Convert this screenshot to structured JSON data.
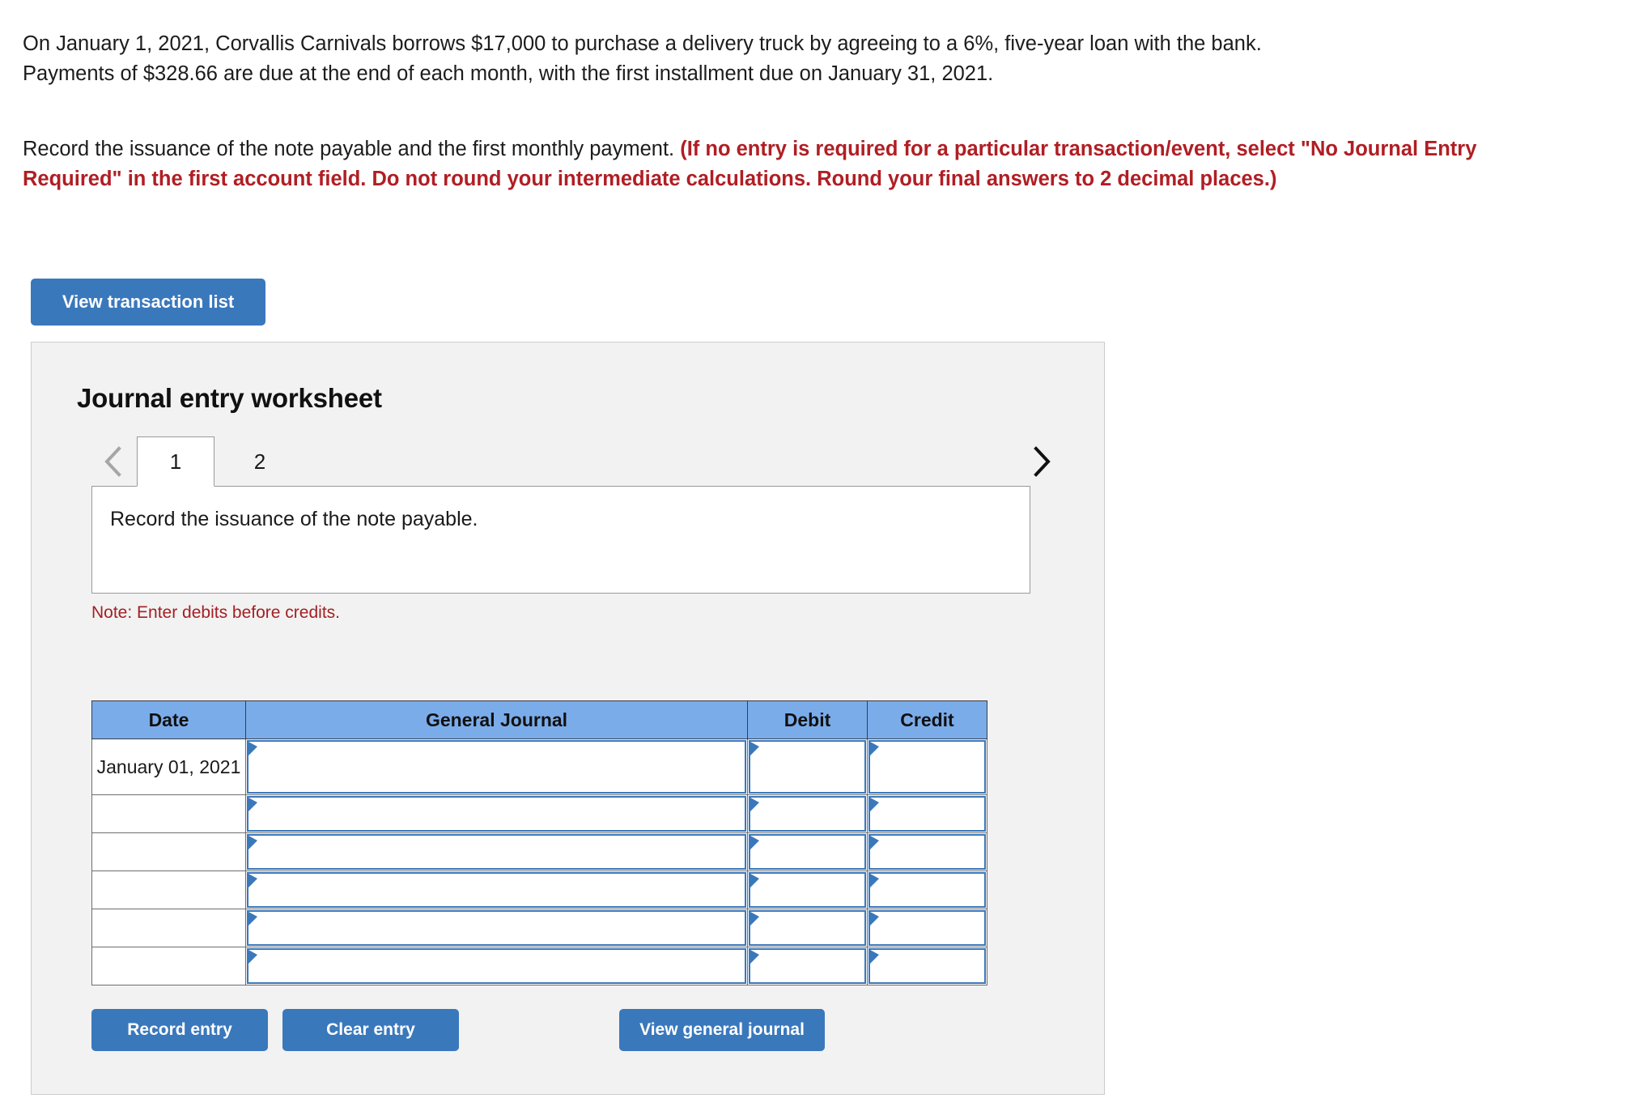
{
  "problem": {
    "line1": "On January 1, 2021, Corvallis Carnivals borrows $17,000 to purchase a delivery truck by agreeing to a 6%, five-year loan with the bank.",
    "line2": "Payments of $328.66 are due at the end of each month, with the first installment due on January 31, 2021."
  },
  "instructions": {
    "plain": "Record the issuance of the note payable and the first monthly payment. ",
    "emphasis": "(If no entry is required for a particular transaction/event, select \"No Journal Entry Required\" in the first account field. Do not round your intermediate calculations. Round your final answers to 2 decimal places.)"
  },
  "toolbar": {
    "view_transaction_list_label": "View transaction list"
  },
  "worksheet": {
    "title": "Journal entry worksheet",
    "tabs": [
      {
        "label": "1",
        "active": true
      },
      {
        "label": "2",
        "active": false
      }
    ],
    "prev_arrow": "chevron-left",
    "next_arrow": "chevron-right",
    "description": "Record the issuance of the note payable.",
    "note": "Note: Enter debits before credits.",
    "table": {
      "headers": [
        "Date",
        "General Journal",
        "Debit",
        "Credit"
      ],
      "rows": [
        {
          "date": "January 01, 2021",
          "general_journal": "",
          "debit": "",
          "credit": ""
        },
        {
          "date": "",
          "general_journal": "",
          "debit": "",
          "credit": ""
        },
        {
          "date": "",
          "general_journal": "",
          "debit": "",
          "credit": ""
        },
        {
          "date": "",
          "general_journal": "",
          "debit": "",
          "credit": ""
        },
        {
          "date": "",
          "general_journal": "",
          "debit": "",
          "credit": ""
        },
        {
          "date": "",
          "general_journal": "",
          "debit": "",
          "credit": ""
        }
      ]
    },
    "actions": {
      "record_entry_label": "Record entry",
      "clear_entry_label": "Clear entry",
      "view_general_journal_label": "View general journal"
    }
  },
  "colors": {
    "button_blue": "#3a78bc",
    "header_blue": "#7bacea",
    "instruction_red": "#b01e24",
    "note_red": "#a32024",
    "panel_gray": "#f2f2f2"
  }
}
